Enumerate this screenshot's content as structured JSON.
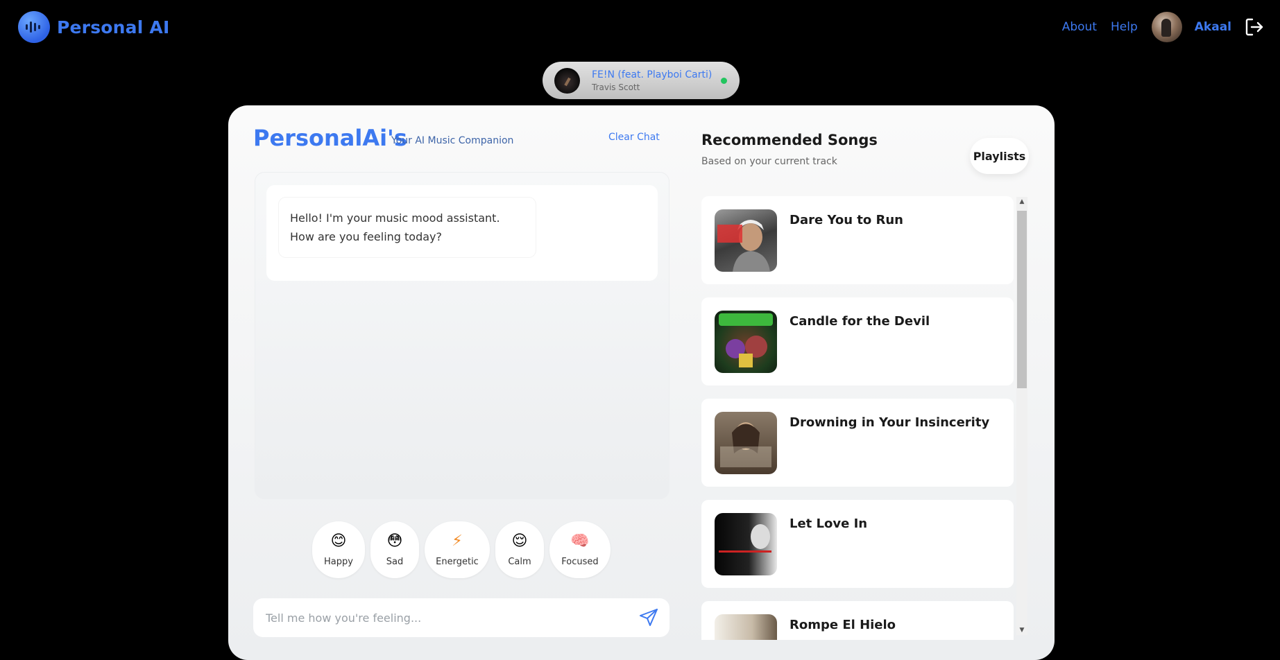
{
  "header": {
    "app_name": "Personal AI",
    "nav": [
      "About",
      "Help"
    ],
    "username": "Akaal"
  },
  "now_playing": {
    "title": "FE!N (feat. Playboi Carti)",
    "artist": "Travis Scott",
    "status_color": "#22c55e"
  },
  "chat": {
    "title": "PersonalAi's",
    "subtitle": "Your AI Music Companion",
    "clear_label": "Clear Chat",
    "messages": [
      {
        "sender": "assistant",
        "text": "Hello! I'm your music mood assistant. How are you feeling today?"
      }
    ],
    "moods": [
      {
        "icon": "smile-icon",
        "glyph": "😊",
        "label": "Happy"
      },
      {
        "icon": "flushed-face-icon",
        "glyph": "😳",
        "label": "Sad"
      },
      {
        "icon": "lightning-icon",
        "glyph": "⚡",
        "label": "Energetic"
      },
      {
        "icon": "relieved-face-icon",
        "glyph": "😌",
        "label": "Calm"
      },
      {
        "icon": "brain-icon",
        "glyph": "🧠",
        "label": "Focused"
      }
    ],
    "input_placeholder": "Tell me how you're feeling..."
  },
  "recommendations": {
    "title": "Recommended Songs",
    "subtitle": "Based on your current track",
    "playlists_label": "Playlists",
    "songs": [
      {
        "title": "Dare You to Run"
      },
      {
        "title": "Candle for the Devil"
      },
      {
        "title": "Drowning in Your Insincerity"
      },
      {
        "title": "Let Love In"
      },
      {
        "title": "Rompe El Hielo"
      }
    ]
  },
  "colors": {
    "accent": "#3d79f0",
    "background": "#000000"
  }
}
